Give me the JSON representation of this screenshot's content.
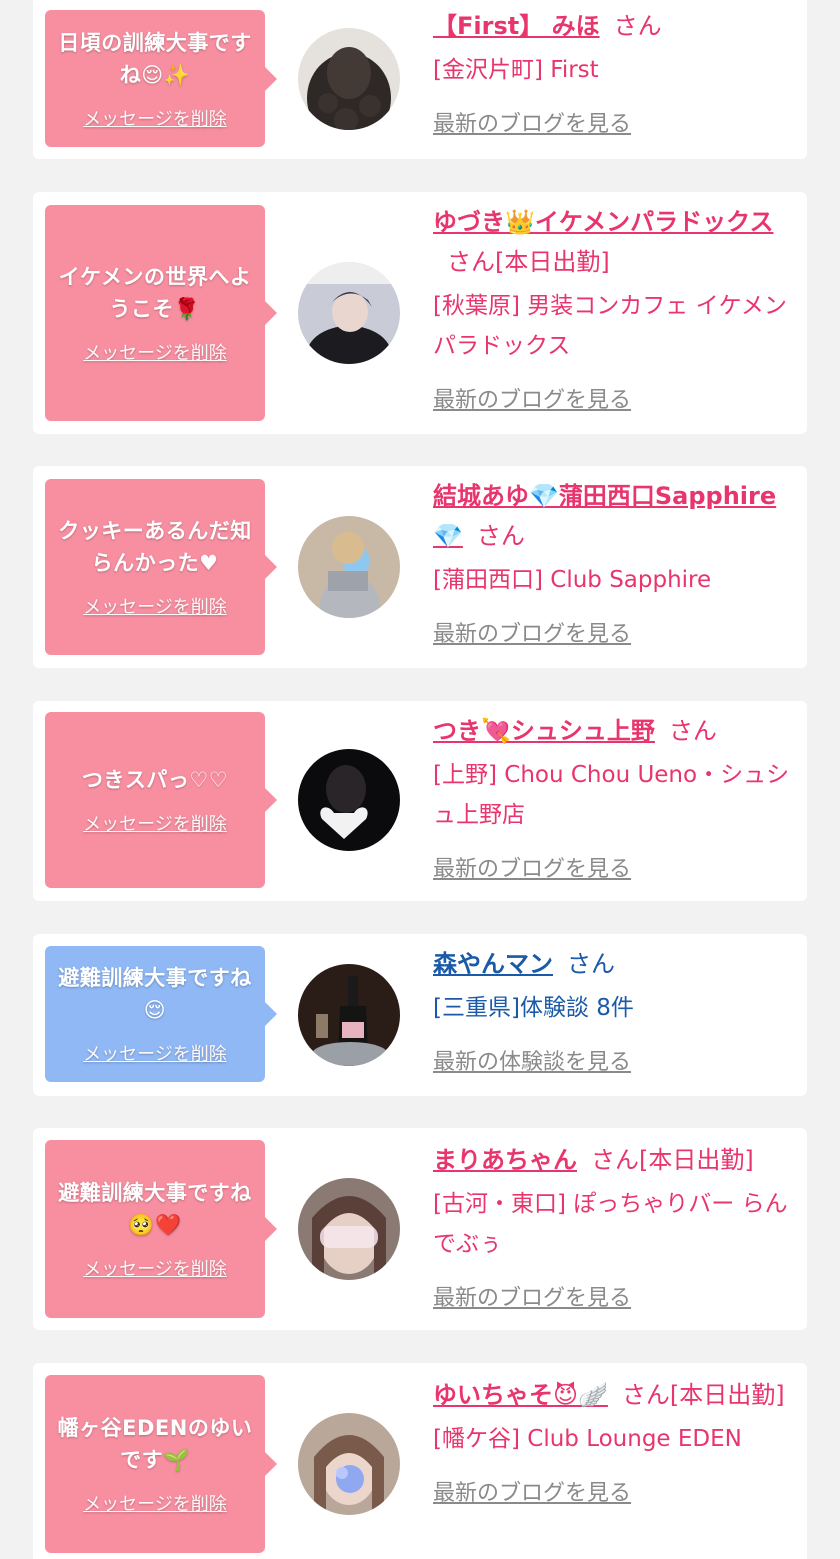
{
  "colors": {
    "bubble_pink": "#f78fa1",
    "bubble_blue": "#8fb8f5",
    "name_pink": "#e8356d",
    "name_blue": "#1a5aa8",
    "blog_gray": "#8a8a8a"
  },
  "cards": [
    {
      "message": "日頃の訓練大事ですね😌✨",
      "delete_label": "メッセージを削除",
      "name": "【First】 みほ",
      "suffix": "さん",
      "shop": "[金沢片町] First",
      "blog_link": "最新のブログを見る",
      "bubble_color": "pink",
      "avatar_icon": "avatar-dark-curly-hair"
    },
    {
      "message": "イケメンの世界へようこそ🌹",
      "delete_label": "メッセージを削除",
      "name": "ゆづき👑イケメンパラドックス",
      "suffix": "さん[本日出勤]",
      "shop": "[秋葉原] 男装コンカフェ イケメンパラドックス",
      "blog_link": "最新のブログを見る",
      "bubble_color": "pink",
      "avatar_icon": "avatar-host-portrait"
    },
    {
      "message": "クッキーあるんだ知らんかった♥",
      "delete_label": "メッセージを削除",
      "name": "結城あゆ💎蒲田西口Sapphire💎",
      "suffix": "さん",
      "shop": "[蒲田西口] Club Sapphire",
      "blog_link": "最新のブログを見る",
      "bubble_color": "pink",
      "avatar_icon": "avatar-dress-photo"
    },
    {
      "message": "つきスパっ♡♡",
      "delete_label": "メッセージを削除",
      "name": "つき💘シュシュ上野",
      "suffix": "さん",
      "shop": "[上野] Chou Chou Ueno・シュシュ上野店",
      "blog_link": "最新のブログを見る",
      "bubble_color": "pink",
      "avatar_icon": "avatar-dark-heart"
    },
    {
      "message": "避難訓練大事ですね😌",
      "delete_label": "メッセージを削除",
      "name": "森やんマン",
      "suffix": "さん",
      "shop": "[三重県]体験談 8件",
      "blog_link": "最新の体験談を見る",
      "bubble_color": "blue",
      "avatar_icon": "avatar-champagne"
    },
    {
      "message": "避難訓練大事ですね🥺❤️",
      "delete_label": "メッセージを削除",
      "name": "まりあちゃん",
      "suffix": "さん[本日出勤]",
      "shop": "[古河・東口] ぽっちゃりバー らんでぶぅ",
      "blog_link": "最新のブログを見る",
      "bubble_color": "pink",
      "avatar_icon": "avatar-happy-sticker"
    },
    {
      "message": "幡ヶ谷EDENのゆいです🌱",
      "delete_label": "メッセージを削除",
      "name": "ゆいちゃそ😈🪽",
      "suffix": "さん[本日出勤]",
      "shop": "[幡ケ谷] Club Lounge EDEN",
      "blog_link": "最新のブログを見る",
      "bubble_color": "pink",
      "avatar_icon": "avatar-blue-flower"
    }
  ]
}
